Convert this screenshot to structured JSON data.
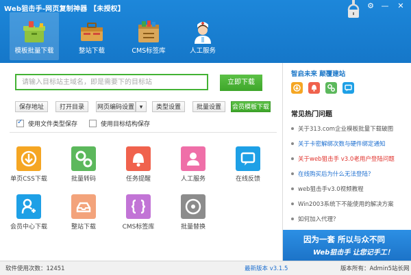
{
  "window": {
    "title": "Web狙击手-网页复制神器 【未授权】",
    "controls": {
      "settings": "⚙",
      "minimize": "—",
      "close": "✕"
    }
  },
  "nav": [
    {
      "label": "模板批量下载",
      "icon": "template-box-icon"
    },
    {
      "label": "整站下载",
      "icon": "toolbox-icon"
    },
    {
      "label": "CMS标签库",
      "icon": "cabinet-icon"
    },
    {
      "label": "人工服务",
      "icon": "nurse-icon"
    }
  ],
  "search": {
    "placeholder": "请输入目标站主域名，即是需要下的目标站",
    "submit": "立即下载"
  },
  "toolbar": {
    "save_path": "保存地址",
    "open_dir": "打开目录",
    "encoding": "网页编码设置",
    "encoding_arrow": "▾",
    "type_settings": "类型设置",
    "batch_settings": "批量设置",
    "member_download": "会员模板下载"
  },
  "options": {
    "use_file_type": "使用文件类型保存",
    "use_target_structure": "使用目标结构保存"
  },
  "tiles": [
    {
      "label": "单页CSS下载",
      "color": "#f5a623"
    },
    {
      "label": "批量转码",
      "color": "#5cb85c"
    },
    {
      "label": "任务提醒",
      "color": "#f0624d"
    },
    {
      "label": "人工服务",
      "color": "#ef6fa8"
    },
    {
      "label": "在线反馈",
      "color": "#1ea0e6"
    },
    {
      "label": "会员中心下载",
      "color": "#1ea0e6"
    },
    {
      "label": "整站下载",
      "color": "#f3a37b"
    },
    {
      "label": "CMS标签库",
      "color": "#c274d6"
    },
    {
      "label": "批量替换",
      "color": "#8c8c8c"
    }
  ],
  "right_panel": {
    "brand": "智启未来 颠覆建站",
    "social_icons": [
      {
        "name": "download-social-icon",
        "color": "#f5a623"
      },
      {
        "name": "bell-social-icon",
        "color": "#f0624d"
      },
      {
        "name": "gear-social-icon",
        "color": "#5cb85c"
      },
      {
        "name": "chat-social-icon",
        "color": "#1ea0e6"
      }
    ],
    "hot_title": "常见热门问题",
    "faqs": [
      {
        "text": "关于313.com企业模板批量下载破图",
        "style": "gray"
      },
      {
        "text": "关于卡密解绑次数与硬件绑定通知",
        "style": "blue"
      },
      {
        "text": "关于web狙击手 v3.0老用户登陆问题",
        "style": "red"
      },
      {
        "text": "在线购买后为什么无法登陆？",
        "style": "blue"
      },
      {
        "text": "web狙击手v3.0视频教程",
        "style": "gray"
      },
      {
        "text": "Win2003系统下不能使用的解决方案",
        "style": "gray"
      },
      {
        "text": "如何加入代理？",
        "style": "gray"
      }
    ],
    "banner_line1": "因为一套 所以与众不同",
    "banner_line2": "Web狙击手 让您记手工！"
  },
  "status": {
    "usage": "软件使用次数：12451",
    "latest_version": "最新版本 v3.1.5",
    "copyright": "版本所有：Admin5站长网"
  }
}
